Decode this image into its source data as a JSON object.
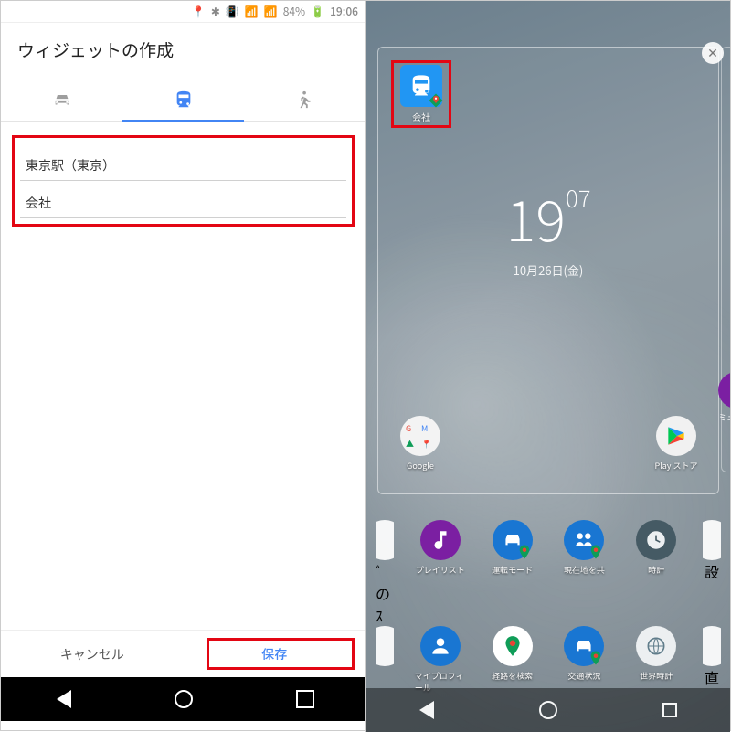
{
  "status_left": {
    "battery": "84%",
    "time": "19:06"
  },
  "left": {
    "title": "ウィジェットの作成",
    "tabs": {
      "car": "car-icon",
      "transit": "transit-icon",
      "walk": "walk-icon",
      "active": 1
    },
    "field_from": "東京駅（東京）",
    "field_to": "会社",
    "cancel": "キャンセル",
    "save": "保存"
  },
  "right": {
    "widget_label": "会社",
    "clock_hour": "19",
    "clock_min": "07",
    "date": "10月26日(金)",
    "preview_apps": [
      {
        "name": "google-folder",
        "label": "Google"
      },
      {
        "name": "play-store",
        "label": "Play ストア"
      }
    ],
    "side_app": {
      "name": "music-app",
      "label": "ミュー"
    },
    "drawer_row1": [
      {
        "name": "unknown-left",
        "label": "ﾞのｽ"
      },
      {
        "name": "playlist",
        "label": "プレイリスト"
      },
      {
        "name": "driving-mode",
        "label": "運転モード"
      },
      {
        "name": "share-location",
        "label": "現在地を共"
      },
      {
        "name": "clock-app",
        "label": "時計"
      },
      {
        "name": "unknown-right",
        "label": "設"
      }
    ],
    "drawer_row2": [
      {
        "name": "unknown-left2",
        "label": ""
      },
      {
        "name": "my-profile",
        "label": "マイプロフィール"
      },
      {
        "name": "search-route",
        "label": "経路を検索"
      },
      {
        "name": "traffic",
        "label": "交通状況"
      },
      {
        "name": "world-clock",
        "label": "世界時計"
      },
      {
        "name": "unknown-right2",
        "label": "直"
      }
    ]
  }
}
